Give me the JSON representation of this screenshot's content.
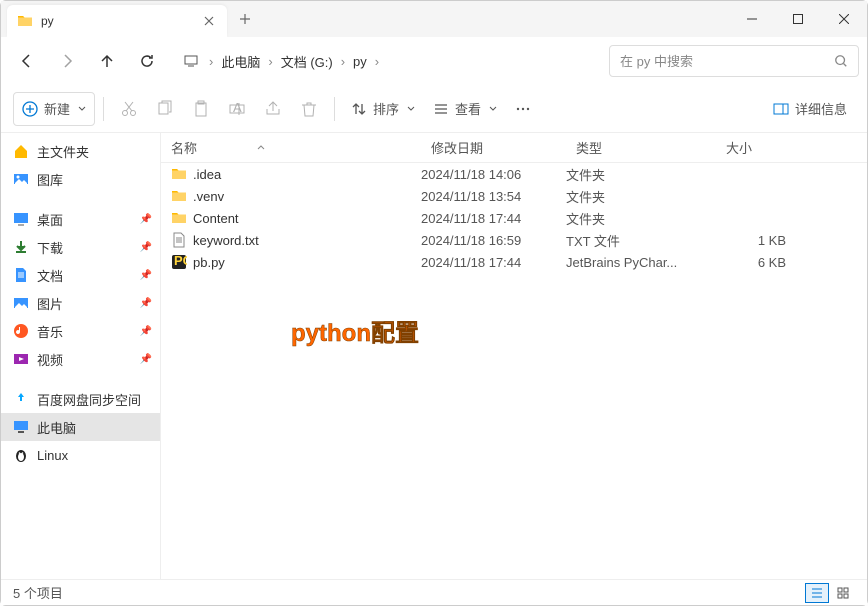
{
  "window": {
    "title": "py"
  },
  "breadcrumbs": [
    "此电脑",
    "文档 (G:)",
    "py"
  ],
  "search": {
    "placeholder": "在 py 中搜索"
  },
  "toolbar": {
    "new_label": "新建",
    "sort_label": "排序",
    "view_label": "查看",
    "details_label": "详细信息"
  },
  "sidebar": {
    "home": "主文件夹",
    "gallery": "图库",
    "desktop": "桌面",
    "downloads": "下载",
    "documents": "文档",
    "pictures": "图片",
    "music": "音乐",
    "videos": "视频",
    "baidu": "百度网盘同步空间",
    "thispc": "此电脑",
    "linux": "Linux"
  },
  "columns": {
    "name": "名称",
    "date": "修改日期",
    "type": "类型",
    "size": "大小"
  },
  "files": [
    {
      "icon": "folder",
      "name": ".idea",
      "date": "2024/11/18 14:06",
      "type": "文件夹",
      "size": ""
    },
    {
      "icon": "folder",
      "name": ".venv",
      "date": "2024/11/18 13:54",
      "type": "文件夹",
      "size": ""
    },
    {
      "icon": "folder",
      "name": "Content",
      "date": "2024/11/18 17:44",
      "type": "文件夹",
      "size": ""
    },
    {
      "icon": "txt",
      "name": "keyword.txt",
      "date": "2024/11/18 16:59",
      "type": "TXT 文件",
      "size": "1 KB"
    },
    {
      "icon": "py",
      "name": "pb.py",
      "date": "2024/11/18 17:44",
      "type": "JetBrains PyChar...",
      "size": "6 KB"
    }
  ],
  "status": {
    "items": "5 个项目"
  },
  "annotation": "python配置"
}
